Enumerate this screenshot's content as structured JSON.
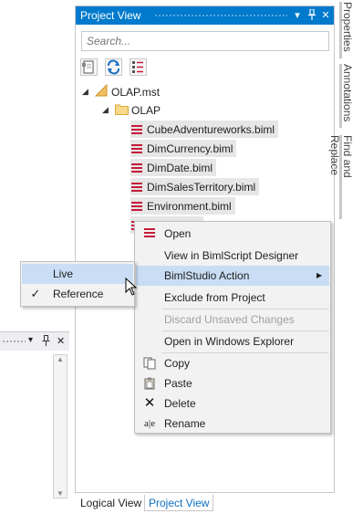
{
  "pane": {
    "title": "Project View",
    "pin_icon": "pin-icon",
    "dropdown_icon": "dropdown-icon",
    "close_icon": "close-icon"
  },
  "search": {
    "placeholder": "Search..."
  },
  "tree": {
    "root": "OLAP.mst",
    "folder": "OLAP",
    "files": [
      "CubeAdventureworks.biml",
      "DimCurrency.biml",
      "DimDate.biml",
      "DimSalesTerritory.biml",
      "Environment.biml"
    ]
  },
  "bottom_tabs": {
    "logical": "Logical View",
    "project": "Project View"
  },
  "side_tabs": {
    "properties": "Properties",
    "annotations": "Annotations",
    "find": "Find and Replace"
  },
  "context_menu": {
    "open": "Open",
    "view_designer": "View in BimlScript Designer",
    "action": "BimlStudio Action",
    "exclude": "Exclude from Project",
    "discard": "Discard Unsaved Changes",
    "explorer": "Open in Windows Explorer",
    "copy": "Copy",
    "paste": "Paste",
    "delete": "Delete",
    "rename": "Rename"
  },
  "submenu": {
    "live": "Live",
    "reference": "Reference"
  },
  "colors": {
    "accent": "#007acc",
    "biml_red": "#c41b38",
    "highlight": "#c9def5"
  }
}
